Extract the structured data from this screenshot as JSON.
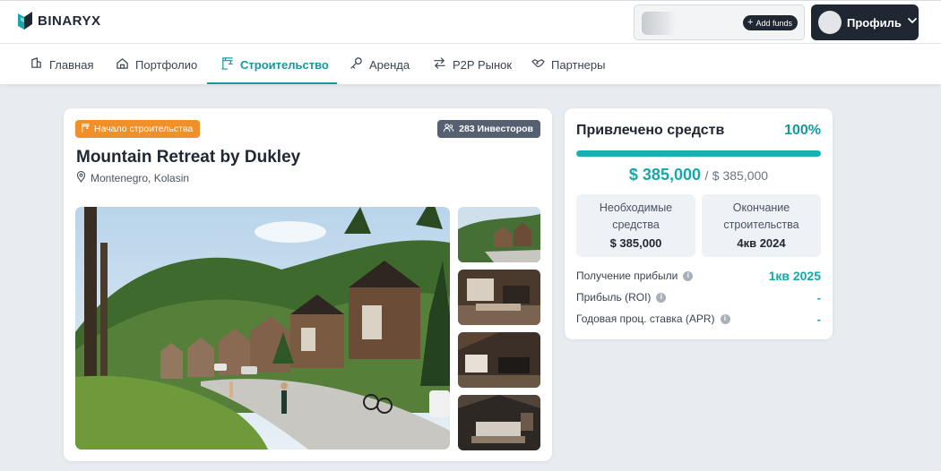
{
  "brand": {
    "name": "BINARYX"
  },
  "header": {
    "add_funds_label": "Add funds",
    "profile_label": "Профиль"
  },
  "nav": {
    "items": [
      {
        "label": "Главная",
        "icon": "home-icon"
      },
      {
        "label": "Портфолио",
        "icon": "portfolio-icon"
      },
      {
        "label": "Строительство",
        "icon": "construction-icon"
      },
      {
        "label": "Аренда",
        "icon": "key-icon"
      },
      {
        "label": "P2P Рынок",
        "icon": "swap-icon"
      },
      {
        "label": "Партнеры",
        "icon": "handshake-icon"
      }
    ],
    "active_index": 2
  },
  "project": {
    "stage_badge": "Начало строительства",
    "investors_badge": "283 Инвесторов",
    "title": "Mountain Retreat by Dukley",
    "location": "Montenegro, Kolasin",
    "thumbnail_count": 4
  },
  "funding": {
    "title": "Привлечено средств",
    "percent_label": "100%",
    "progress_fraction": 1.0,
    "raised_amount": "$ 385,000",
    "separator": "/",
    "total_amount": "$ 385,000",
    "stats": [
      {
        "label": "Необходимые средства",
        "value": "$ 385,000"
      },
      {
        "label": "Окончание строительства",
        "value": "4кв 2024"
      }
    ],
    "metrics": [
      {
        "label": "Получение прибыли",
        "value": "1кв 2025"
      },
      {
        "label": "Прибыль (ROI)",
        "value": "-"
      },
      {
        "label": "Годовая проц. ставка (APR)",
        "value": "-"
      }
    ]
  },
  "colors": {
    "accent": "#139a9d",
    "badge_orange": "#f0902a",
    "badge_gray": "#556171",
    "dark": "#1f2733"
  }
}
